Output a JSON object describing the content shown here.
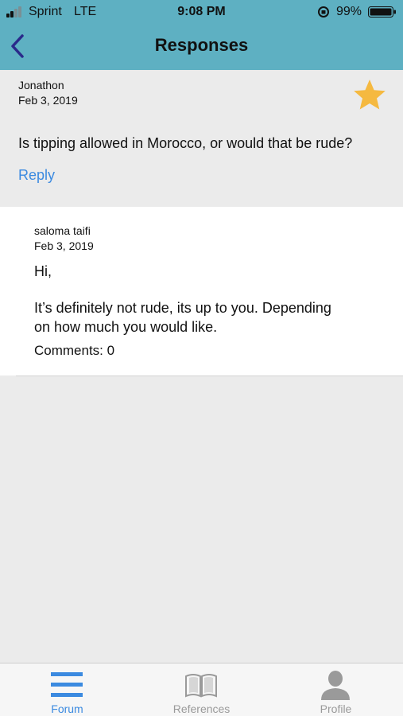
{
  "status_bar": {
    "carrier": "Sprint",
    "network": "LTE",
    "time": "9:08 PM",
    "battery_percent": "99%"
  },
  "nav": {
    "title": "Responses",
    "back_icon": "chevron-left-icon"
  },
  "question": {
    "author": "Jonathon",
    "date": "Feb 3, 2019",
    "text": "Is tipping allowed in Morocco, or would that be rude?",
    "reply_label": "Reply",
    "favorite_icon": "star-icon",
    "favorite_color": "#f5b940"
  },
  "responses": [
    {
      "author": "saloma taifi",
      "date": "Feb 3, 2019",
      "greeting": "Hi,",
      "body": "It’s definitely not rude, its up to you. Depending\non how much you would like.",
      "comments_label": "Comments: 0"
    }
  ],
  "tab_bar": {
    "tabs": [
      {
        "label": "Forum",
        "icon": "menu-icon",
        "active": true
      },
      {
        "label": "References",
        "icon": "book-icon",
        "active": false
      },
      {
        "label": "Profile",
        "icon": "person-icon",
        "active": false
      }
    ],
    "active_color": "#3b8ae0",
    "inactive_color": "#9a9a9a"
  },
  "colors": {
    "header": "#5eb0c2",
    "link": "#3b8ae0",
    "back_chevron": "#2a2a8a"
  }
}
